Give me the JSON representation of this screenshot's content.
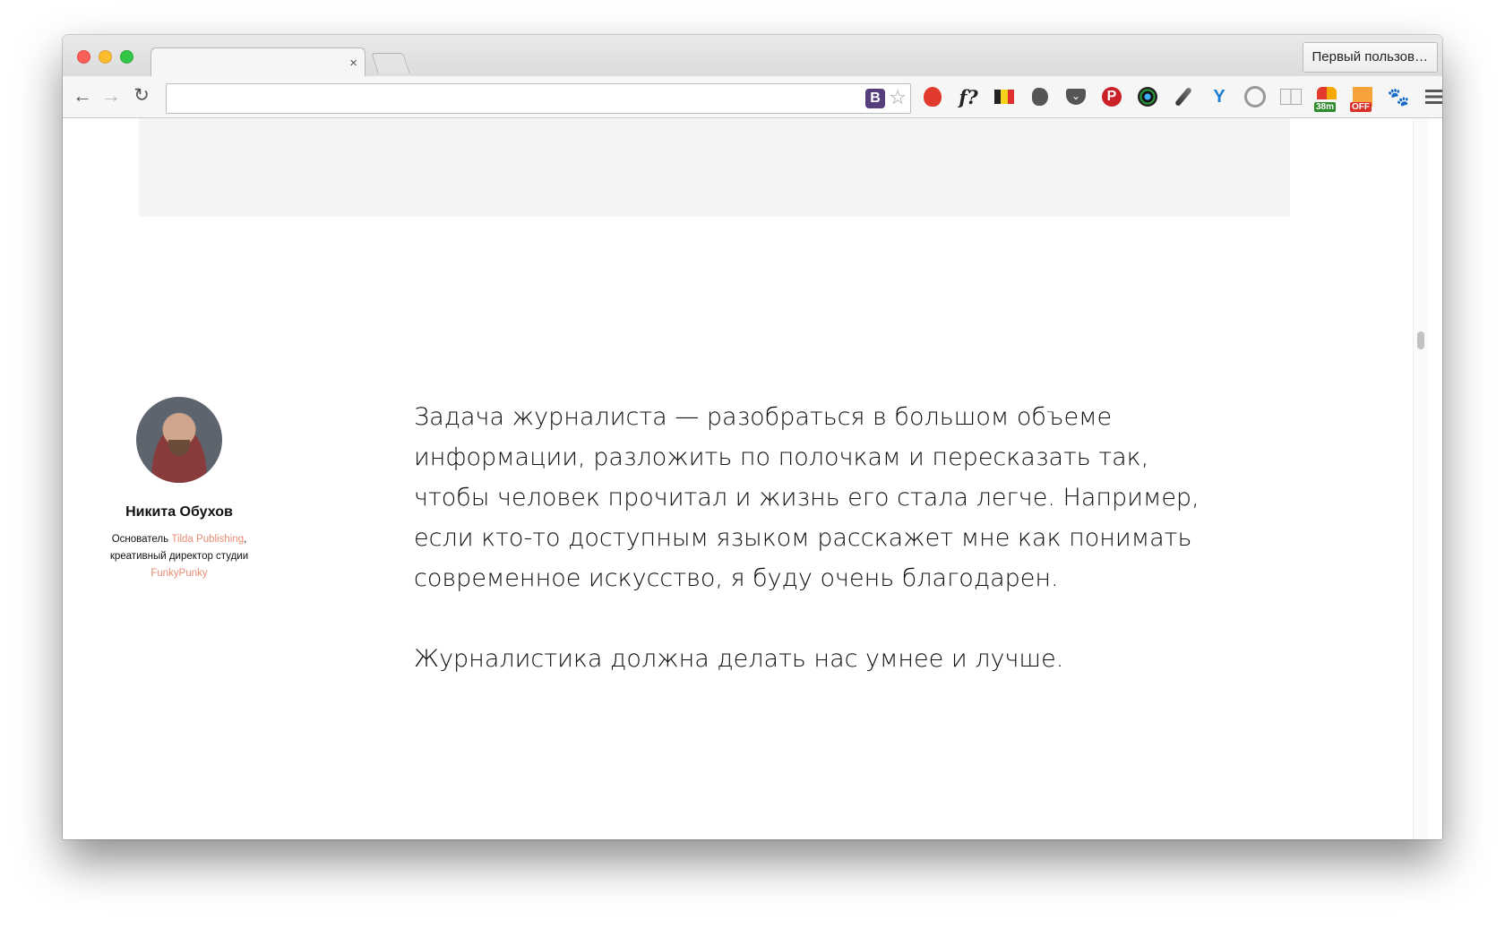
{
  "browser": {
    "tab_close_glyph": "×",
    "profile_button": "Первый пользов…",
    "nav": {
      "back_glyph": "←",
      "forward_glyph": "→",
      "reload_glyph": "↻"
    },
    "omnibox": {
      "value": "",
      "bootstrap_badge": "B",
      "star_glyph": "☆"
    },
    "extensions": [
      {
        "name": "adblock-icon"
      },
      {
        "name": "whatfont-icon",
        "label": "f?"
      },
      {
        "name": "belgium-flag-icon",
        "colors": [
          "#222222",
          "#f5d31a",
          "#e0302e"
        ]
      },
      {
        "name": "evernote-icon"
      },
      {
        "name": "pocket-icon"
      },
      {
        "name": "pinterest-icon",
        "label": "P"
      },
      {
        "name": "lens-icon"
      },
      {
        "name": "eyedropper-icon"
      },
      {
        "name": "y-icon",
        "label": "Y"
      },
      {
        "name": "ring-icon"
      },
      {
        "name": "reader-icon"
      },
      {
        "name": "timer-icon",
        "badge": "38m"
      },
      {
        "name": "sale-icon",
        "badge": "OFF"
      },
      {
        "name": "paw-icon"
      },
      {
        "name": "menu-icon"
      }
    ]
  },
  "author": {
    "name": "Никита Обухов",
    "bio_prefix": "Основатель ",
    "bio_link_1": "Tilda Publishing",
    "bio_middle": ", креативный директор студии ",
    "bio_link_2": "FunkyPunky"
  },
  "article": {
    "paragraphs": [
      "Задача журналиста — разобраться в большом объеме информации, разложить по полочкам и пересказать так, чтобы человек прочитал и жизнь его стала легче. Например, если кто-то доступным языком расскажет мне как понимать современное искусство, я буду очень благодарен.",
      "Журналистика должна делать нас умнее и лучше."
    ]
  },
  "colors": {
    "accent_link": "#e78b73",
    "text": "#111111",
    "gray_block": "#f4f4f4"
  }
}
